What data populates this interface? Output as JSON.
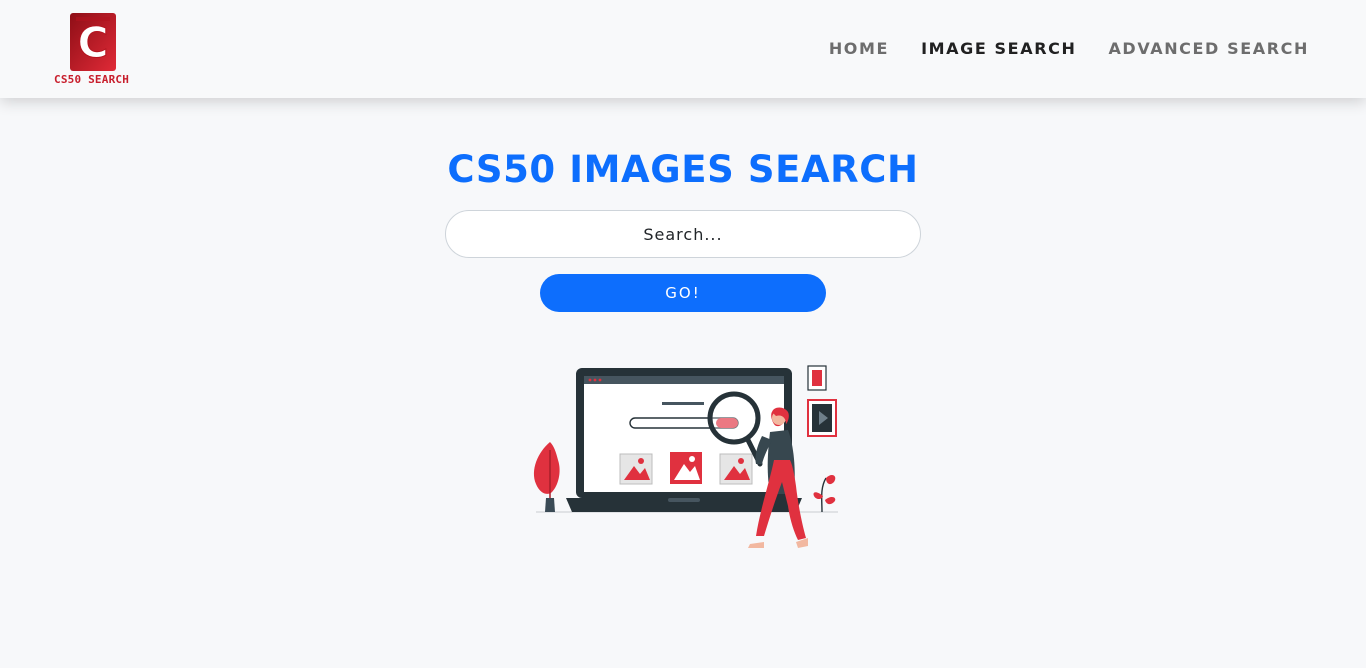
{
  "brand": {
    "name": "CS50 SEARCH",
    "logo_letter": "C"
  },
  "nav": {
    "items": [
      {
        "label": "HOME",
        "active": false
      },
      {
        "label": "IMAGE SEARCH",
        "active": true
      },
      {
        "label": "ADVANCED SEARCH",
        "active": false
      }
    ]
  },
  "main": {
    "title": "CS50 IMAGES SEARCH",
    "search": {
      "placeholder": "Search...",
      "value": ""
    },
    "go_label": "GO!"
  },
  "colors": {
    "accent": "#0d6efd",
    "brand_red": "#c81e2c",
    "illustration_red": "#e0313f",
    "illustration_dark": "#263238"
  },
  "icons": [
    "cs50-logo-icon",
    "image-search-illustration",
    "image-placeholder-icon",
    "magnifying-glass-icon",
    "play-icon",
    "plant-icon"
  ]
}
